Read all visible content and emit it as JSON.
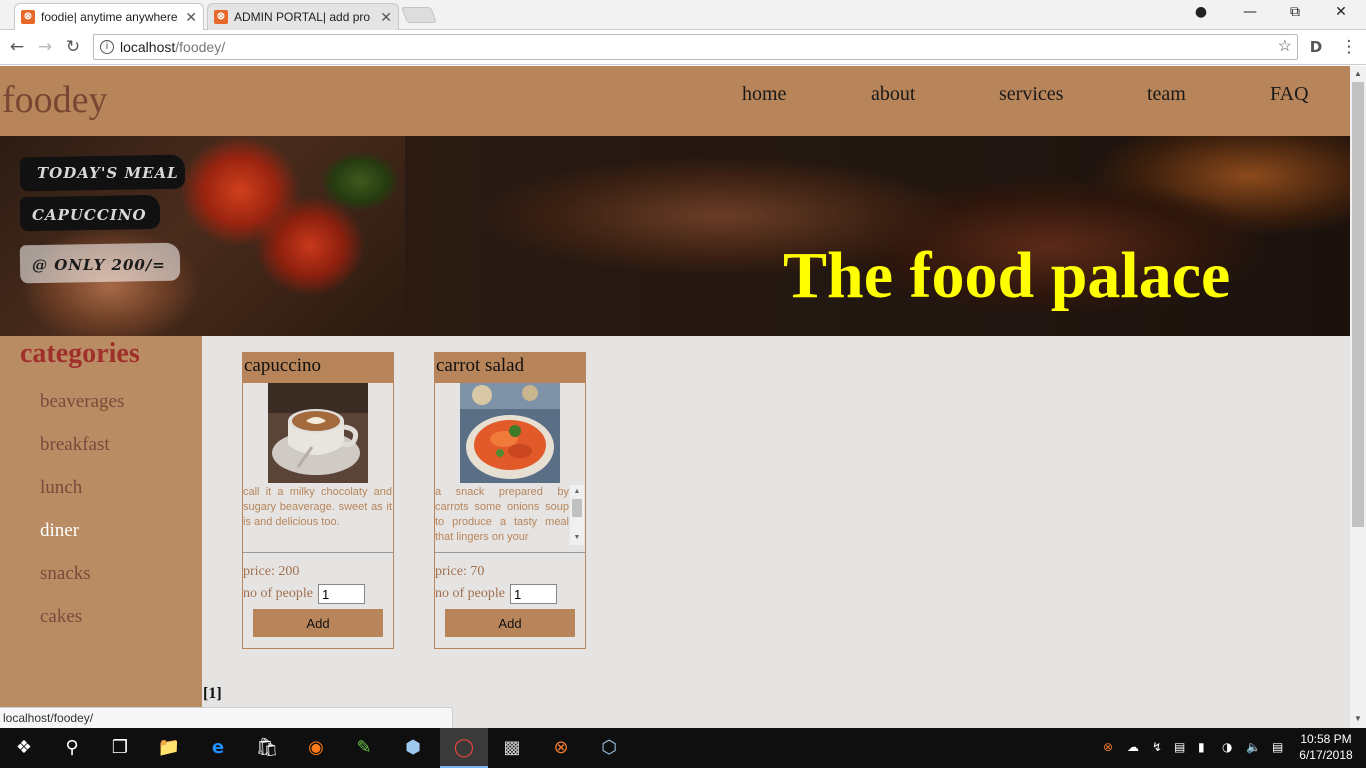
{
  "browser": {
    "tabs": [
      {
        "title": "foodie| anytime anywhere",
        "icon": "xampp-icon"
      },
      {
        "title": "ADMIN PORTAL| add pro",
        "icon": "xampp-icon"
      }
    ],
    "url_host": "localhost",
    "url_path": "/foodey/",
    "status_text": "localhost/foodey/"
  },
  "site": {
    "logo": "foodey",
    "nav": [
      "home",
      "about",
      "services",
      "team",
      "FAQ"
    ]
  },
  "hero": {
    "todays_meal_label": "TODAY'S MEAL",
    "meal_name": "CAPUCCINO",
    "price_tag": "@ ONLY 200/=",
    "slogan": "The food palace"
  },
  "categories": {
    "title": "categories",
    "items": [
      "beaverages",
      "breakfast",
      "lunch",
      "diner",
      "snacks",
      "cakes"
    ],
    "active": "diner"
  },
  "products": [
    {
      "name": "capuccino",
      "description": "call it a milky chocolaty and sugary beaverage. sweet as it is and delicious too.",
      "price_label": "price: 200",
      "people_label": "no of people",
      "people_value": "1",
      "button": "Add"
    },
    {
      "name": "carrot salad",
      "description": "a snack prepared by carrots some onions soup to produce a tasty meal that lingers on your",
      "price_label": "price: 70",
      "people_label": "no of people",
      "people_value": "1",
      "button": "Add"
    }
  ],
  "pagination": "[1]",
  "taskbar": {
    "time": "10:58 PM",
    "date": "6/17/2018"
  },
  "colors": {
    "header": "#b8855a",
    "slogan": "#ffff00",
    "category_title": "#a0302a"
  }
}
